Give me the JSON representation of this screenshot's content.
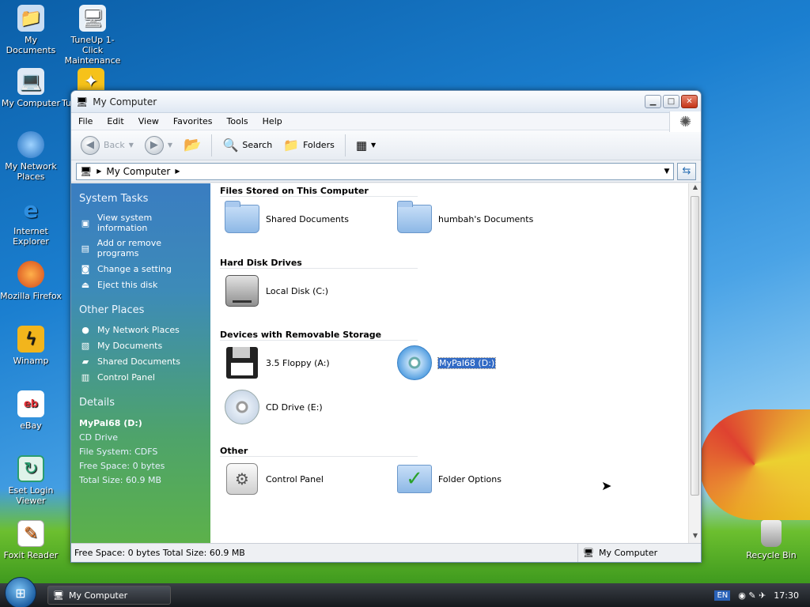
{
  "desktop": {
    "icons": [
      {
        "label": "My Documents",
        "icon": "my-documents-icon"
      },
      {
        "label": "TuneUp 1-Click Maintenance",
        "icon": "tuneup-icon"
      },
      {
        "label": "My Computer",
        "icon": "computer-icon"
      },
      {
        "label": "Tu",
        "icon": "tuneup-utilities-icon"
      },
      {
        "label": "My Network Places",
        "icon": "network-icon"
      },
      {
        "label": "Internet Explorer",
        "icon": "ie-icon"
      },
      {
        "label": "Mozilla Firefox",
        "icon": "firefox-icon"
      },
      {
        "label": "Winamp",
        "icon": "winamp-icon"
      },
      {
        "label": "eBay",
        "icon": "ebay-icon"
      },
      {
        "label": "Eset Login Viewer",
        "icon": "eset-icon"
      },
      {
        "label": "Foxit Reader",
        "icon": "foxit-icon"
      },
      {
        "label": "Recycle Bin",
        "icon": "recycle-bin-icon"
      }
    ]
  },
  "window": {
    "title": "My Computer",
    "menu": [
      "File",
      "Edit",
      "View",
      "Favorites",
      "Tools",
      "Help"
    ],
    "toolbar": {
      "back": "Back",
      "search": "Search",
      "folders": "Folders"
    },
    "address": "My Computer"
  },
  "tasks": {
    "system_title": "System Tasks",
    "system": [
      "View system information",
      "Add or remove programs",
      "Change a setting",
      "Eject this disk"
    ],
    "other_title": "Other Places",
    "other": [
      "My Network Places",
      "My Documents",
      "Shared Documents",
      "Control Panel"
    ],
    "details_title": "Details",
    "details": {
      "name": "MyPal68 (D:)",
      "type": "CD Drive",
      "fs": "File System: CDFS",
      "free": "Free Space: 0 bytes",
      "total": "Total Size: 60.9 MB"
    }
  },
  "sections": [
    {
      "title": "Files Stored on This Computer",
      "items": [
        {
          "label": "Shared Documents",
          "icon": "folder"
        },
        {
          "label": "humbah's Documents",
          "icon": "folder"
        }
      ]
    },
    {
      "title": "Hard Disk Drives",
      "items": [
        {
          "label": "Local Disk (C:)",
          "icon": "disk"
        }
      ]
    },
    {
      "title": "Devices with Removable Storage",
      "items": [
        {
          "label": "3.5 Floppy (A:)",
          "icon": "floppy"
        },
        {
          "label": "MyPal68 (D:)",
          "icon": "cd-blue"
        },
        {
          "label": "CD Drive (E:)",
          "icon": "cd"
        }
      ]
    },
    {
      "title": "Other",
      "items": [
        {
          "label": "Control Panel",
          "icon": "control-panel"
        },
        {
          "label": "Folder Options",
          "icon": "folder-options"
        }
      ]
    }
  ],
  "status": {
    "left": "Free Space: 0 bytes Total Size: 60.9 MB",
    "right": "My Computer"
  },
  "taskbar": {
    "button": "My Computer",
    "lang": "EN",
    "time": "17:30"
  }
}
